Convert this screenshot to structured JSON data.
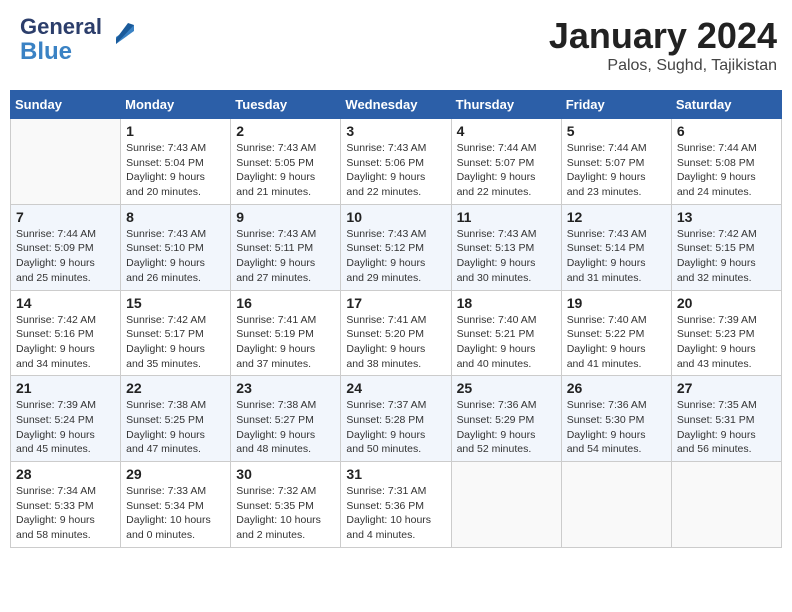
{
  "header": {
    "logo_line1": "General",
    "logo_line2": "Blue",
    "month_title": "January 2024",
    "location": "Palos, Sughd, Tajikistan"
  },
  "days_of_week": [
    "Sunday",
    "Monday",
    "Tuesday",
    "Wednesday",
    "Thursday",
    "Friday",
    "Saturday"
  ],
  "weeks": [
    [
      {
        "num": "",
        "sunrise": "",
        "sunset": "",
        "daylight": ""
      },
      {
        "num": "1",
        "sunrise": "Sunrise: 7:43 AM",
        "sunset": "Sunset: 5:04 PM",
        "daylight": "Daylight: 9 hours and 20 minutes."
      },
      {
        "num": "2",
        "sunrise": "Sunrise: 7:43 AM",
        "sunset": "Sunset: 5:05 PM",
        "daylight": "Daylight: 9 hours and 21 minutes."
      },
      {
        "num": "3",
        "sunrise": "Sunrise: 7:43 AM",
        "sunset": "Sunset: 5:06 PM",
        "daylight": "Daylight: 9 hours and 22 minutes."
      },
      {
        "num": "4",
        "sunrise": "Sunrise: 7:44 AM",
        "sunset": "Sunset: 5:07 PM",
        "daylight": "Daylight: 9 hours and 22 minutes."
      },
      {
        "num": "5",
        "sunrise": "Sunrise: 7:44 AM",
        "sunset": "Sunset: 5:07 PM",
        "daylight": "Daylight: 9 hours and 23 minutes."
      },
      {
        "num": "6",
        "sunrise": "Sunrise: 7:44 AM",
        "sunset": "Sunset: 5:08 PM",
        "daylight": "Daylight: 9 hours and 24 minutes."
      }
    ],
    [
      {
        "num": "7",
        "sunrise": "Sunrise: 7:44 AM",
        "sunset": "Sunset: 5:09 PM",
        "daylight": "Daylight: 9 hours and 25 minutes."
      },
      {
        "num": "8",
        "sunrise": "Sunrise: 7:43 AM",
        "sunset": "Sunset: 5:10 PM",
        "daylight": "Daylight: 9 hours and 26 minutes."
      },
      {
        "num": "9",
        "sunrise": "Sunrise: 7:43 AM",
        "sunset": "Sunset: 5:11 PM",
        "daylight": "Daylight: 9 hours and 27 minutes."
      },
      {
        "num": "10",
        "sunrise": "Sunrise: 7:43 AM",
        "sunset": "Sunset: 5:12 PM",
        "daylight": "Daylight: 9 hours and 29 minutes."
      },
      {
        "num": "11",
        "sunrise": "Sunrise: 7:43 AM",
        "sunset": "Sunset: 5:13 PM",
        "daylight": "Daylight: 9 hours and 30 minutes."
      },
      {
        "num": "12",
        "sunrise": "Sunrise: 7:43 AM",
        "sunset": "Sunset: 5:14 PM",
        "daylight": "Daylight: 9 hours and 31 minutes."
      },
      {
        "num": "13",
        "sunrise": "Sunrise: 7:42 AM",
        "sunset": "Sunset: 5:15 PM",
        "daylight": "Daylight: 9 hours and 32 minutes."
      }
    ],
    [
      {
        "num": "14",
        "sunrise": "Sunrise: 7:42 AM",
        "sunset": "Sunset: 5:16 PM",
        "daylight": "Daylight: 9 hours and 34 minutes."
      },
      {
        "num": "15",
        "sunrise": "Sunrise: 7:42 AM",
        "sunset": "Sunset: 5:17 PM",
        "daylight": "Daylight: 9 hours and 35 minutes."
      },
      {
        "num": "16",
        "sunrise": "Sunrise: 7:41 AM",
        "sunset": "Sunset: 5:19 PM",
        "daylight": "Daylight: 9 hours and 37 minutes."
      },
      {
        "num": "17",
        "sunrise": "Sunrise: 7:41 AM",
        "sunset": "Sunset: 5:20 PM",
        "daylight": "Daylight: 9 hours and 38 minutes."
      },
      {
        "num": "18",
        "sunrise": "Sunrise: 7:40 AM",
        "sunset": "Sunset: 5:21 PM",
        "daylight": "Daylight: 9 hours and 40 minutes."
      },
      {
        "num": "19",
        "sunrise": "Sunrise: 7:40 AM",
        "sunset": "Sunset: 5:22 PM",
        "daylight": "Daylight: 9 hours and 41 minutes."
      },
      {
        "num": "20",
        "sunrise": "Sunrise: 7:39 AM",
        "sunset": "Sunset: 5:23 PM",
        "daylight": "Daylight: 9 hours and 43 minutes."
      }
    ],
    [
      {
        "num": "21",
        "sunrise": "Sunrise: 7:39 AM",
        "sunset": "Sunset: 5:24 PM",
        "daylight": "Daylight: 9 hours and 45 minutes."
      },
      {
        "num": "22",
        "sunrise": "Sunrise: 7:38 AM",
        "sunset": "Sunset: 5:25 PM",
        "daylight": "Daylight: 9 hours and 47 minutes."
      },
      {
        "num": "23",
        "sunrise": "Sunrise: 7:38 AM",
        "sunset": "Sunset: 5:27 PM",
        "daylight": "Daylight: 9 hours and 48 minutes."
      },
      {
        "num": "24",
        "sunrise": "Sunrise: 7:37 AM",
        "sunset": "Sunset: 5:28 PM",
        "daylight": "Daylight: 9 hours and 50 minutes."
      },
      {
        "num": "25",
        "sunrise": "Sunrise: 7:36 AM",
        "sunset": "Sunset: 5:29 PM",
        "daylight": "Daylight: 9 hours and 52 minutes."
      },
      {
        "num": "26",
        "sunrise": "Sunrise: 7:36 AM",
        "sunset": "Sunset: 5:30 PM",
        "daylight": "Daylight: 9 hours and 54 minutes."
      },
      {
        "num": "27",
        "sunrise": "Sunrise: 7:35 AM",
        "sunset": "Sunset: 5:31 PM",
        "daylight": "Daylight: 9 hours and 56 minutes."
      }
    ],
    [
      {
        "num": "28",
        "sunrise": "Sunrise: 7:34 AM",
        "sunset": "Sunset: 5:33 PM",
        "daylight": "Daylight: 9 hours and 58 minutes."
      },
      {
        "num": "29",
        "sunrise": "Sunrise: 7:33 AM",
        "sunset": "Sunset: 5:34 PM",
        "daylight": "Daylight: 10 hours and 0 minutes."
      },
      {
        "num": "30",
        "sunrise": "Sunrise: 7:32 AM",
        "sunset": "Sunset: 5:35 PM",
        "daylight": "Daylight: 10 hours and 2 minutes."
      },
      {
        "num": "31",
        "sunrise": "Sunrise: 7:31 AM",
        "sunset": "Sunset: 5:36 PM",
        "daylight": "Daylight: 10 hours and 4 minutes."
      },
      {
        "num": "",
        "sunrise": "",
        "sunset": "",
        "daylight": ""
      },
      {
        "num": "",
        "sunrise": "",
        "sunset": "",
        "daylight": ""
      },
      {
        "num": "",
        "sunrise": "",
        "sunset": "",
        "daylight": ""
      }
    ]
  ]
}
